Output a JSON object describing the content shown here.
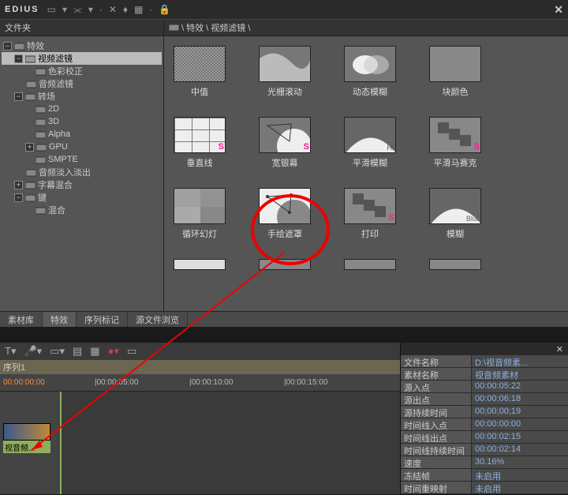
{
  "app": {
    "name": "EDIUS"
  },
  "sidebar": {
    "title": "文件夹"
  },
  "tree": {
    "root": "特效",
    "videoFilter": "视频滤镜",
    "colorCorrect": "色彩校正",
    "audioFilter": "音频滤镜",
    "transition": "转场",
    "t2d": "2D",
    "t3d": "3D",
    "alpha": "Alpha",
    "gpu": "GPU",
    "smpte": "SMPTE",
    "audioFade": "音频淡入淡出",
    "titleMix": "字幕混合",
    "key": "键",
    "mix": "混合"
  },
  "breadcrumb": {
    "path": "\\ 特效 \\ 视频滤镜 \\"
  },
  "effects": {
    "median": "中值",
    "raster": "光栅滚动",
    "motionBlur": "动态模糊",
    "blockColor": "块颜色",
    "vertical": "垂直线",
    "widescreen": "宽银幕",
    "smoothBlur": "平滑模糊",
    "smoothMosaic": "平滑马赛克",
    "slideshow": "循环幻灯",
    "handMask": "手绘遮罩",
    "print": "打印",
    "blur": "模糊"
  },
  "tabs": {
    "lib": "素材库",
    "fx": "特效",
    "marker": "序列标记",
    "browser": "源文件浏览"
  },
  "sequence": {
    "name": "序列1"
  },
  "timecodes": {
    "t0": "00:00:00;00",
    "t1": "|00:00:05:00",
    "t2": "|00:00:10:00",
    "t3": "|00:00:15:00"
  },
  "clip": {
    "label": "视音频..."
  },
  "props": [
    {
      "k": "文件名称",
      "v": "D:\\视音频素..."
    },
    {
      "k": "素材名称",
      "v": "视音频素材"
    },
    {
      "k": "源入点",
      "v": "00:00:05:22"
    },
    {
      "k": "源出点",
      "v": "00:00:06:18"
    },
    {
      "k": "源持续时间",
      "v": "00;00;00;19"
    },
    {
      "k": "时间线入点",
      "v": "00:00:00:00"
    },
    {
      "k": "时间线出点",
      "v": "00:00:02:15"
    },
    {
      "k": "时间线持续时间",
      "v": "00:00:02:14"
    },
    {
      "k": "速度",
      "v": "30.16%"
    },
    {
      "k": "冻结帧",
      "v": "未启用"
    },
    {
      "k": "时间重映射",
      "v": "未启用"
    }
  ]
}
